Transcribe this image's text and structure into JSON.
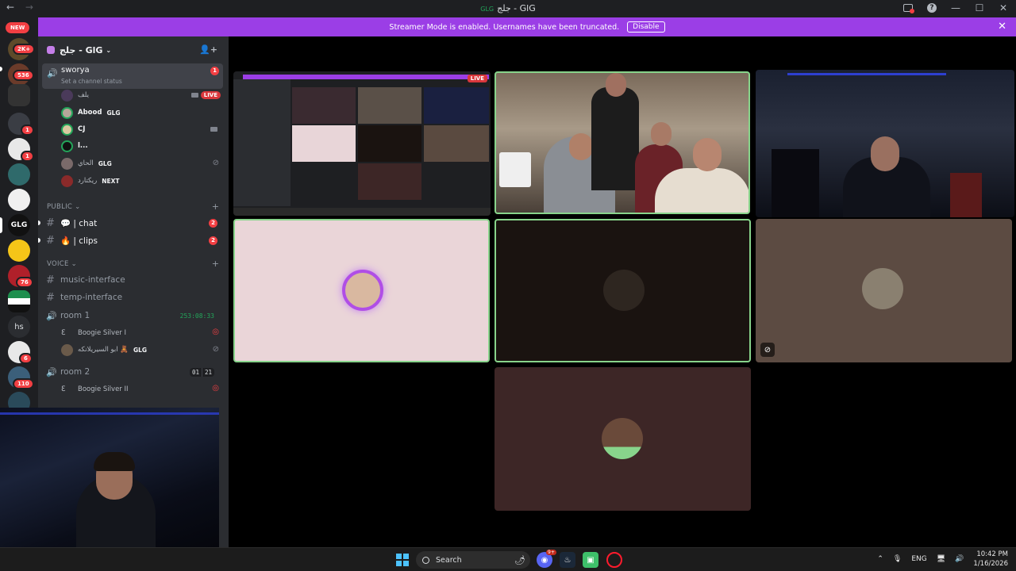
{
  "window": {
    "title": "جلج - GlG",
    "title_prefix": "GLG"
  },
  "banner": {
    "message": "Streamer Mode is enabled. Usernames have been truncated.",
    "disable_label": "Disable"
  },
  "rail": {
    "new_label": "NEW",
    "badges": [
      "2K+",
      "536",
      "1",
      "1",
      "76",
      "6",
      "110"
    ],
    "glg_label": "GLG",
    "hs_label": "hs"
  },
  "guild": {
    "name": "جلج - GlG"
  },
  "active_voice": {
    "name": "sworya",
    "status": "Set a channel status",
    "count": "1"
  },
  "members_room0": [
    {
      "name": "يلف",
      "live": "LIVE"
    },
    {
      "name": "Abood",
      "tag": "GLG"
    },
    {
      "name": "CJ"
    },
    {
      "name": "l..."
    },
    {
      "name": "الحاي",
      "tag": "GLG"
    },
    {
      "name": "ريكتارد",
      "tag": "NEXT"
    }
  ],
  "categories": {
    "public": "PUBLIC",
    "voice": "VOICE"
  },
  "channels": [
    {
      "name": "💬 | chat",
      "badge": "2"
    },
    {
      "name": "🔥 | clips",
      "badge": "2"
    }
  ],
  "voice_text_channels": [
    "music-interface",
    "temp-interface"
  ],
  "room1": {
    "name": "room 1",
    "timer": "253:08:33",
    "members": [
      {
        "name": "Boogie Silver I"
      },
      {
        "name": "ابو السيريلانكه 🧸",
        "tag": "GLG"
      }
    ]
  },
  "room2": {
    "name": "room 2",
    "count_a": "01",
    "count_b": "21",
    "members": [
      {
        "name": "Boogie Silver II"
      }
    ]
  },
  "stage": {
    "live_label": "LIVE"
  },
  "taskbar": {
    "search_label": "Search",
    "lang": "ENG",
    "time": "10:42 PM",
    "date": "1/16/2026",
    "discord_badge": "9+"
  },
  "colors": {
    "accent_purple": "#9b3ee6",
    "speaking_green": "#88d48b",
    "badge_red": "#f23f43",
    "voice_green": "#23a55a"
  }
}
